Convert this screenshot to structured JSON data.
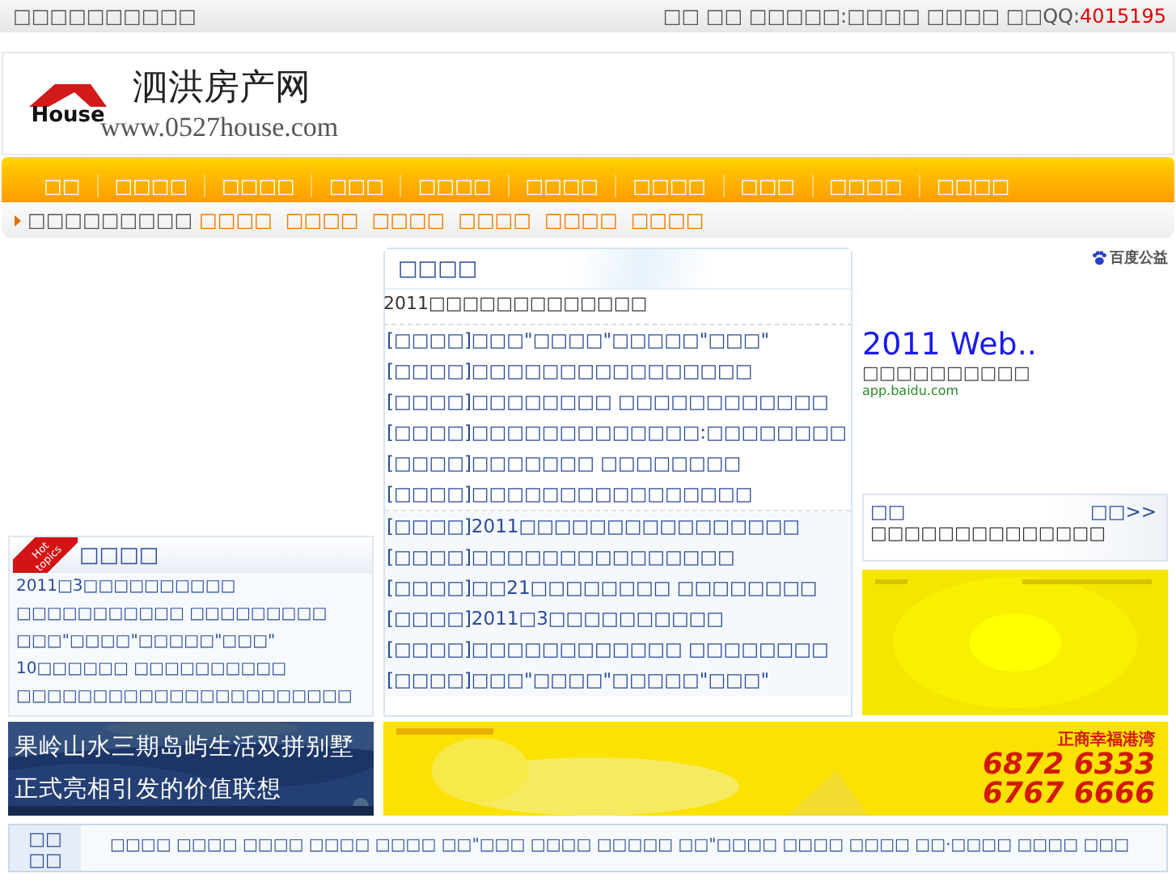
{
  "top_bar": {
    "left_text": "□□□□□□□□□□",
    "right_text": "□□ □□ □□□□□:□□□□ □□□□ □□QQ:",
    "qq_number": "4015195"
  },
  "header": {
    "logo_text": "House",
    "site_name": "泗洪房产网",
    "url": "www.0527house.com"
  },
  "nav": [
    "□□",
    "□□□□",
    "□□□□",
    "□□□",
    "□□□□",
    "□□□□",
    "□□□□",
    "□□□",
    "□□□□",
    "□□□□"
  ],
  "sub_nav": {
    "label": "□□□□□□□□□",
    "links": [
      "□□□□",
      "□□□□",
      "□□□□",
      "□□□□",
      "□□□□",
      "□□□□"
    ]
  },
  "hot_topics": {
    "badge": "Hot topics",
    "title": "□□□□",
    "items": [
      "2011□3□□□□□□□□□□",
      "□□□□□□□□□□□ □□□□□□□□□",
      "□□□\"□□□□\"□□□□□\"□□□\"",
      "10□□□□□□ □□□□□□□□□□",
      "□□□□□□□□□□□□□□□□□□□□□□"
    ]
  },
  "news": {
    "title": "□□□□",
    "headline": "2011□□□□□□□□□□□□□",
    "groups": [
      [
        "[□□□□]□□□\"□□□□\"□□□□□\"□□□\"",
        "[□□□□]□□□□□□□□□□□□□□□□",
        "[□□□□]□□□□□□□□ □□□□□□□□□□□□",
        "[□□□□]□□□□□□□□□□□□□:□□□□□□□□",
        "[□□□□]□□□□□□□ □□□□□□□□",
        "[□□□□]□□□□□□□□□□□□□□□□"
      ],
      [
        "[□□□□]2011□□□□□□□□□□□□□□□□",
        "[□□□□]□□□□□□□□□□□□□□□",
        "[□□□□]□□21□□□□□□□□ □□□□□□□□",
        "[□□□□]2011□3□□□□□□□□□□",
        "[□□□□]□□□□□□□□□□□□ □□□□□□□□",
        "[□□□□]□□□\"□□□□\"□□□□□\"□□□\""
      ]
    ]
  },
  "baidu_ad": {
    "brand": "百度公益",
    "headline": "2011 Web..",
    "text": "□□□□□□□□□□",
    "url": "app.baidu.com"
  },
  "notice": {
    "title": "□□",
    "more": "□□>>",
    "text": "□□□□□□□□□□□□□□"
  },
  "banners": [
    {
      "kind": "text",
      "lines": [
        "果岭山水三期岛屿生活双拼别墅",
        "正式亮相引发的价值联想"
      ]
    },
    {
      "kind": "phones",
      "brand": "正商幸福港湾",
      "phones": [
        "6872 6333",
        "6767 6666"
      ]
    }
  ],
  "ticker": {
    "label": "□□□□",
    "text": "□□□□ □□□□ □□□□ □□□□ □□□□ □□\"□□□ □□□□ □□□□□ □□\"□□□□ □□□□ □□□□ □□·□□□□ □□□□ □□□"
  }
}
